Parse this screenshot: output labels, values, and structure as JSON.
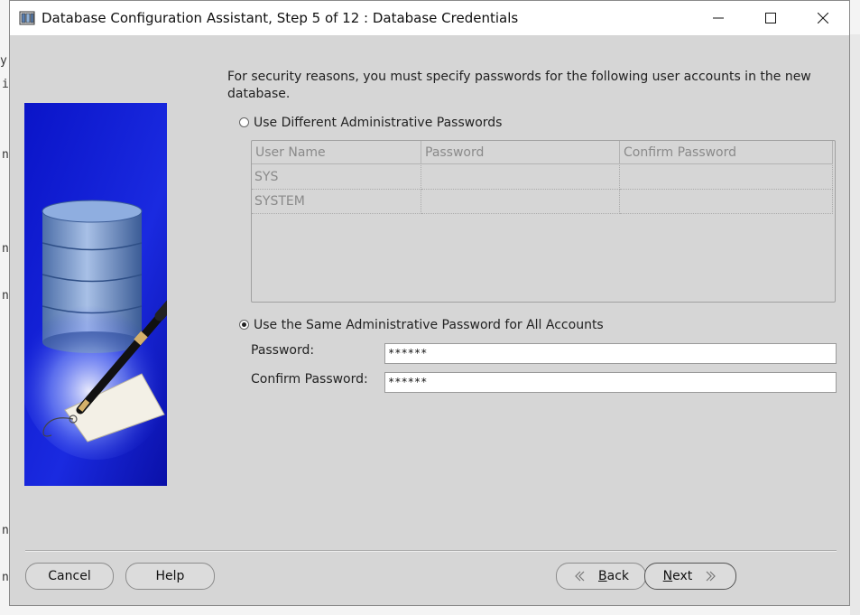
{
  "window": {
    "title": "Database Configuration Assistant, Step 5 of 12 : Database Credentials"
  },
  "intro": "For security reasons, you must specify passwords for the following user accounts in the new database.",
  "options": {
    "different": {
      "label": "Use Different Administrative Passwords",
      "selected": false
    },
    "same": {
      "label": "Use the Same Administrative Password for All Accounts",
      "selected": true
    }
  },
  "grid": {
    "headers": [
      "User Name",
      "Password",
      "Confirm Password"
    ],
    "rows": [
      {
        "user": "SYS",
        "password": "",
        "confirm": ""
      },
      {
        "user": "SYSTEM",
        "password": "",
        "confirm": ""
      }
    ]
  },
  "form": {
    "password_label": "Password:",
    "password_value": "******",
    "confirm_label": "Confirm Password:",
    "confirm_value": "******"
  },
  "buttons": {
    "cancel": "Cancel",
    "help": "Help",
    "back_mnemonic": "B",
    "back_rest": "ack",
    "next_mnemonic": "N",
    "next_rest": "ext"
  }
}
